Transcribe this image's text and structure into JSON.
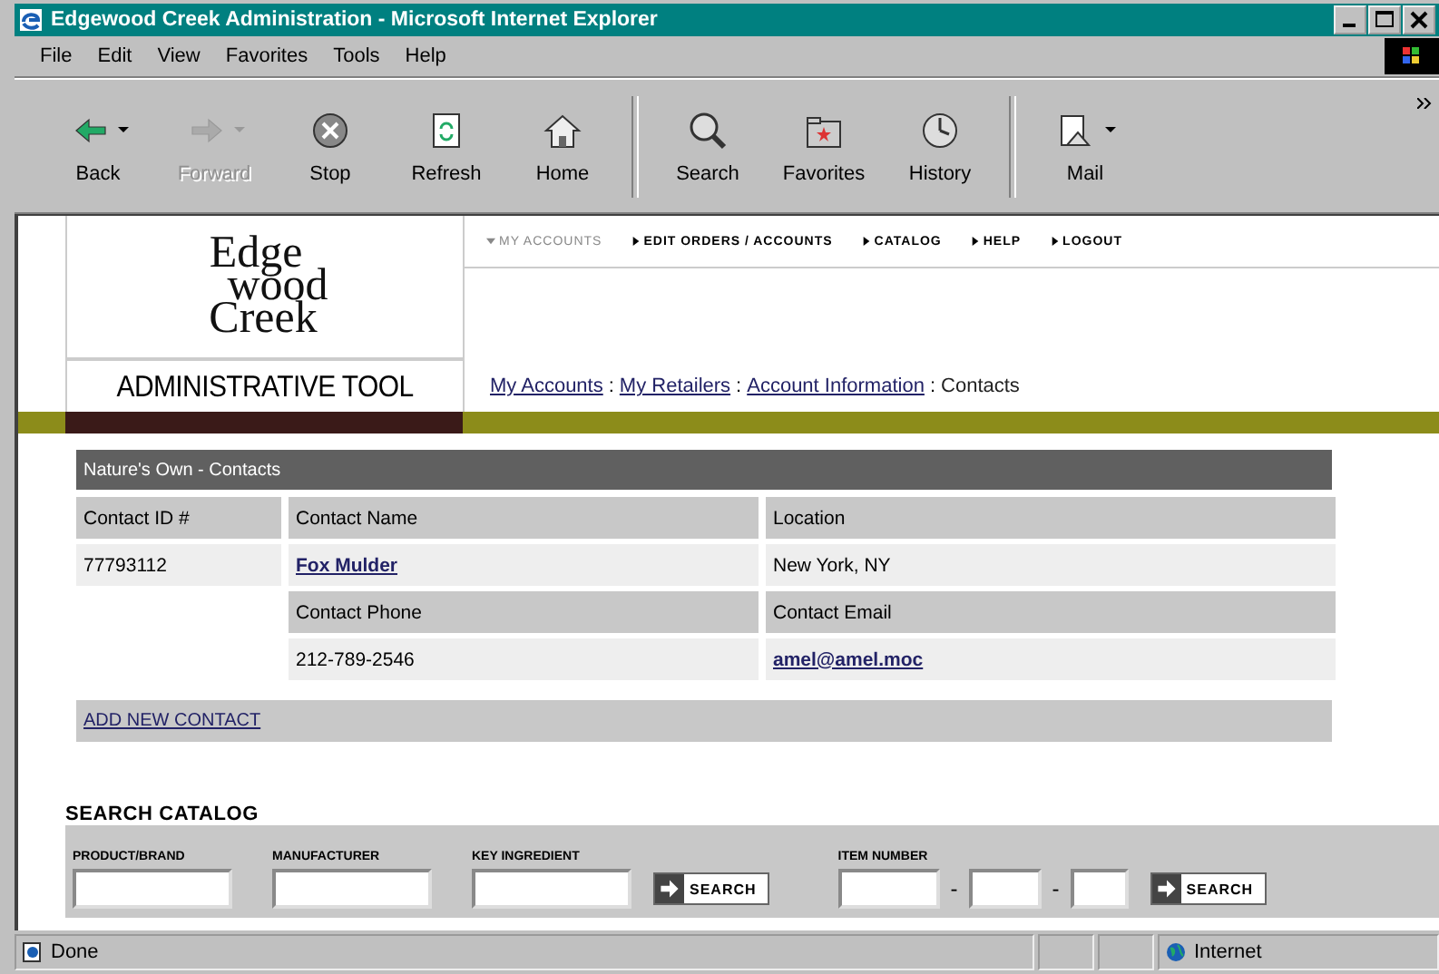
{
  "window": {
    "title": "Edgewood Creek Administration - Microsoft Internet Explorer"
  },
  "menu": [
    "File",
    "Edit",
    "View",
    "Favorites",
    "Tools",
    "Help"
  ],
  "toolbar": [
    {
      "kind": "back",
      "label": "Back",
      "disabled": false,
      "dropdown": true
    },
    {
      "kind": "forward",
      "label": "Forward",
      "disabled": true,
      "dropdown": true
    },
    {
      "kind": "stop",
      "label": "Stop",
      "disabled": false,
      "dropdown": false
    },
    {
      "kind": "refresh",
      "label": "Refresh",
      "disabled": false,
      "dropdown": false
    },
    {
      "kind": "home",
      "label": "Home",
      "disabled": false,
      "dropdown": false
    },
    {
      "kind": "search",
      "label": "Search",
      "disabled": false,
      "dropdown": false
    },
    {
      "kind": "favorites",
      "label": "Favorites",
      "disabled": false,
      "dropdown": false
    },
    {
      "kind": "history",
      "label": "History",
      "disabled": false,
      "dropdown": false
    },
    {
      "kind": "mail",
      "label": "Mail",
      "disabled": false,
      "dropdown": true
    }
  ],
  "logo": {
    "lines": [
      "Edge",
      "wood",
      "Creek"
    ],
    "subtitle": "ADMINISTRATIVE TOOL"
  },
  "nav": [
    {
      "label": "MY ACCOUNTS",
      "selected": true
    },
    {
      "label": "EDIT ORDERS / ACCOUNTS",
      "selected": false
    },
    {
      "label": "CATALOG",
      "selected": false
    },
    {
      "label": "HELP",
      "selected": false
    },
    {
      "label": "LOGOUT",
      "selected": false
    }
  ],
  "breadcrumb": {
    "separator": ":",
    "items": [
      {
        "label": "My Accounts",
        "kind": "link"
      },
      {
        "label": "My Retailers",
        "kind": "link"
      },
      {
        "label": "Account Information",
        "kind": "link"
      },
      {
        "label": "Contacts",
        "kind": "current"
      }
    ]
  },
  "contacts": {
    "title": "Nature's Own - Contacts",
    "rows": [
      [
        {
          "kind": "label",
          "text": "Contact ID #"
        },
        {
          "kind": "label",
          "text": "Contact Name"
        },
        {
          "kind": "label",
          "text": "Location"
        }
      ],
      [
        {
          "kind": "value",
          "text": "77793112"
        },
        {
          "kind": "link",
          "text": "Fox Mulder"
        },
        {
          "kind": "value",
          "text": "New York, NY"
        }
      ],
      [
        {
          "kind": "blank"
        },
        {
          "kind": "label",
          "text": "Contact Phone"
        },
        {
          "kind": "label",
          "text": "Contact Email"
        }
      ],
      [
        {
          "kind": "blank"
        },
        {
          "kind": "value",
          "text": "212-789-2546"
        },
        {
          "kind": "link",
          "text": "amel@amel.moc"
        }
      ]
    ],
    "add_link": "ADD NEW CONTACT"
  },
  "search_catalog": {
    "title": "SEARCH CATALOG",
    "fields": [
      {
        "label": "PRODUCT/BRAND"
      },
      {
        "label": "MANUFACTURER"
      },
      {
        "label": "KEY INGREDIENT"
      }
    ],
    "button": "SEARCH",
    "item_number": {
      "label": "ITEM NUMBER",
      "separator": "-"
    },
    "button_2": "SEARCH"
  },
  "status_bar": {
    "text": "Done",
    "zone": "Internet"
  }
}
